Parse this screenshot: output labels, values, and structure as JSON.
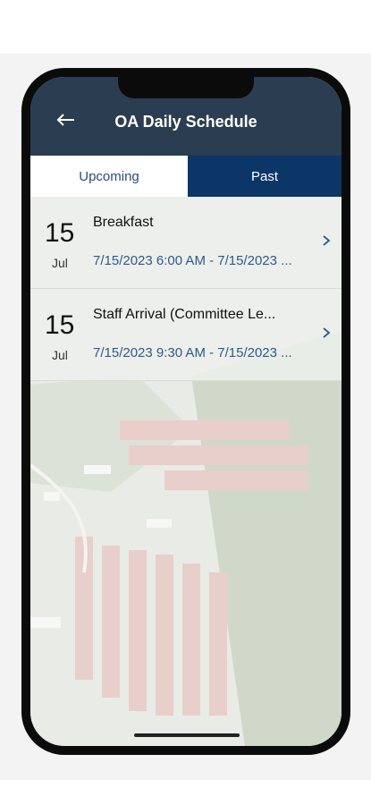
{
  "header": {
    "title": "OA Daily Schedule",
    "back_icon": "arrow-left-icon"
  },
  "tabs": [
    {
      "label": "Upcoming",
      "active": false
    },
    {
      "label": "Past",
      "active": true
    }
  ],
  "events": [
    {
      "day": "15",
      "month": "Jul",
      "name": "Breakfast",
      "time": "7/15/2023 6:00 AM - 7/15/2023 ..."
    },
    {
      "day": "15",
      "month": "Jul",
      "name": "Staff Arrival (Committee Le...",
      "time": "7/15/2023 9:30 AM - 7/15/2023 ..."
    }
  ],
  "colors": {
    "header_bg": "#2b3d50",
    "tab_active_bg": "#0b3667",
    "time_text": "#2c5a8c"
  }
}
